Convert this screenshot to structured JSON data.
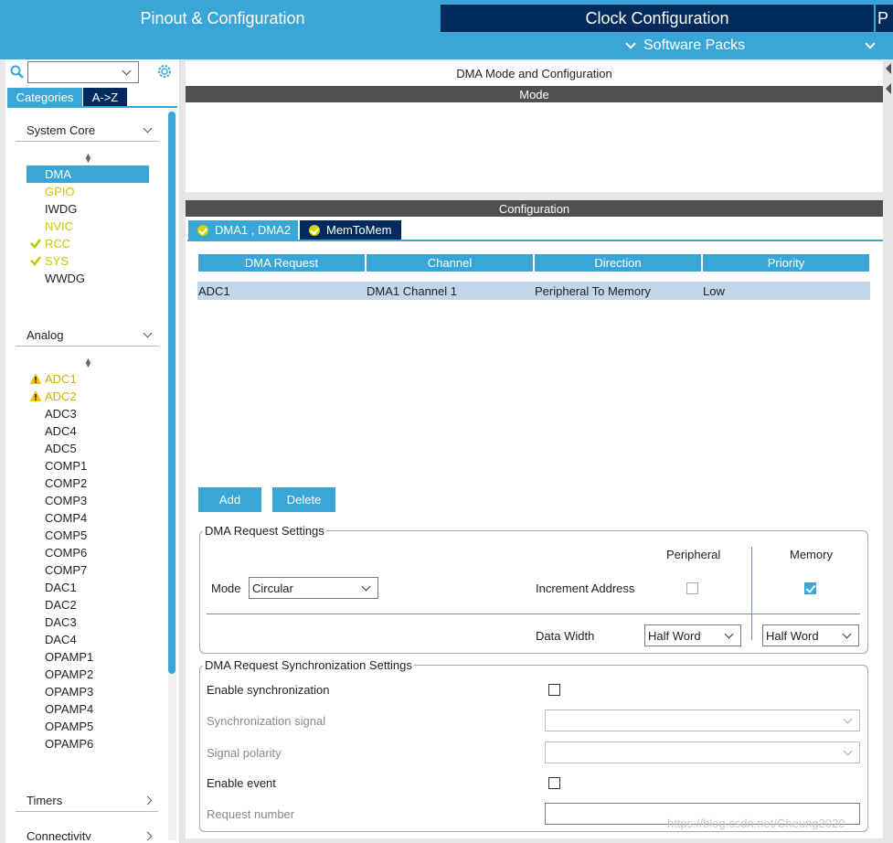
{
  "header": {
    "tab_pinout": "Pinout & Configuration",
    "tab_clock": "Clock Configuration",
    "tab_p": "P",
    "software_packs": "Software Packs",
    "colors": {
      "accent": "#3aa6d8",
      "dark": "#002b5c"
    }
  },
  "sidebar": {
    "search": {
      "value": "",
      "placeholder": ""
    },
    "tabs": [
      "Categories",
      "A->Z"
    ],
    "sections": {
      "system_core": {
        "label": "System Core",
        "items": [
          {
            "label": "DMA",
            "state": "selected"
          },
          {
            "label": "GPIO",
            "state": "configured"
          },
          {
            "label": "IWDG",
            "state": "normal"
          },
          {
            "label": "NVIC",
            "state": "configured"
          },
          {
            "label": "RCC",
            "state": "ok"
          },
          {
            "label": "SYS",
            "state": "ok"
          },
          {
            "label": "WWDG",
            "state": "normal"
          }
        ]
      },
      "analog": {
        "label": "Analog",
        "items": [
          {
            "label": "ADC1",
            "state": "warning"
          },
          {
            "label": "ADC2",
            "state": "warning"
          },
          {
            "label": "ADC3",
            "state": "normal"
          },
          {
            "label": "ADC4",
            "state": "normal"
          },
          {
            "label": "ADC5",
            "state": "normal"
          },
          {
            "label": "COMP1",
            "state": "normal"
          },
          {
            "label": "COMP2",
            "state": "normal"
          },
          {
            "label": "COMP3",
            "state": "normal"
          },
          {
            "label": "COMP4",
            "state": "normal"
          },
          {
            "label": "COMP5",
            "state": "normal"
          },
          {
            "label": "COMP6",
            "state": "normal"
          },
          {
            "label": "COMP7",
            "state": "normal"
          },
          {
            "label": "DAC1",
            "state": "normal"
          },
          {
            "label": "DAC2",
            "state": "normal"
          },
          {
            "label": "DAC3",
            "state": "normal"
          },
          {
            "label": "DAC4",
            "state": "normal"
          },
          {
            "label": "OPAMP1",
            "state": "normal"
          },
          {
            "label": "OPAMP2",
            "state": "normal"
          },
          {
            "label": "OPAMP3",
            "state": "normal"
          },
          {
            "label": "OPAMP4",
            "state": "normal"
          },
          {
            "label": "OPAMP5",
            "state": "normal"
          },
          {
            "label": "OPAMP6",
            "state": "normal"
          }
        ]
      },
      "timers": {
        "label": "Timers"
      },
      "connectivity": {
        "label": "Connectivity"
      }
    }
  },
  "main": {
    "title": "DMA Mode and Configuration",
    "mode_header": "Mode",
    "config_header": "Configuration",
    "config_tabs": [
      "DMA1 , DMA2",
      "MemToMem"
    ],
    "table": {
      "columns": [
        "DMA Request",
        "Channel",
        "Direction",
        "Priority"
      ],
      "rows": [
        [
          "ADC1",
          "DMA1 Channel 1",
          "Peripheral To Memory",
          "Low"
        ]
      ]
    },
    "buttons": {
      "add": "Add",
      "delete": "Delete"
    },
    "request_settings": {
      "legend": "DMA Request Settings",
      "peripheral_label": "Peripheral",
      "memory_label": "Memory",
      "mode_label": "Mode",
      "mode_value": "Circular",
      "increment_label": "Increment Address",
      "peripheral_increment": false,
      "memory_increment": true,
      "data_width_label": "Data Width",
      "peripheral_width": "Half Word",
      "memory_width": "Half Word"
    },
    "sync_settings": {
      "legend": "DMA Request Synchronization Settings",
      "enable_sync_label": "Enable synchronization",
      "sync_signal_label": "Synchronization signal",
      "sync_signal_value": "",
      "signal_polarity_label": "Signal polarity",
      "signal_polarity_value": "",
      "enable_event_label": "Enable event",
      "request_number_label": "Request number",
      "request_number_value": ""
    },
    "watermark": "https://blog.csdn.net/Cheung2020"
  }
}
